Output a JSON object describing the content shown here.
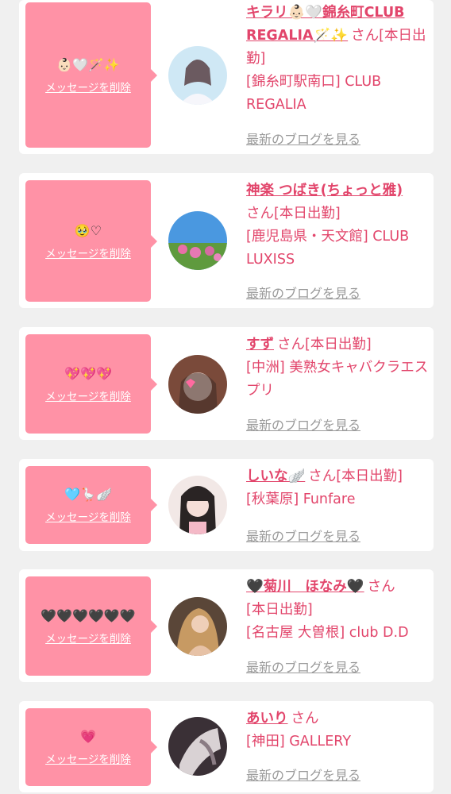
{
  "delete_label": "メッセージを削除",
  "san_label": "さん",
  "blog_label": "最新のブログを見る",
  "colors": {
    "accent": "#e2456b",
    "bubble": "#ff92a6",
    "card": "#ffffff",
    "background": "#f0f0f0",
    "muted": "#9a9a9a"
  },
  "messages": [
    {
      "message": "👶🏻🤍🪄✨",
      "name": "キラリ👶🏻🤍錦糸町CLUB REGALIA🪄✨",
      "status": "[本日出勤]",
      "shop": "[錦糸町駅南口] CLUB REGALIA"
    },
    {
      "message": "🥹♡",
      "name": "神楽 つばき(ちょっと雅)",
      "status": "[本日出勤]",
      "shop": "[鹿児島県・天文館] CLUB LUXISS"
    },
    {
      "message": "💖💖💖",
      "name": "すず",
      "status": "[本日出勤]",
      "shop": "[中洲] 美熟女キャバクラエスプリ"
    },
    {
      "message": "🩵🪿🪽",
      "name": "しいな🪽",
      "status": "[本日出勤]",
      "shop": "[秋葉原] Funfare"
    },
    {
      "message": "🖤🖤🖤🖤🖤🖤",
      "name": "🖤菊川　ほなみ🖤",
      "status": "[本日出勤]",
      "shop": "[名古屋 大曽根] club D.D"
    },
    {
      "message": "💗",
      "name": "あいり",
      "status": "",
      "shop": "[神田] GALLERY"
    }
  ]
}
